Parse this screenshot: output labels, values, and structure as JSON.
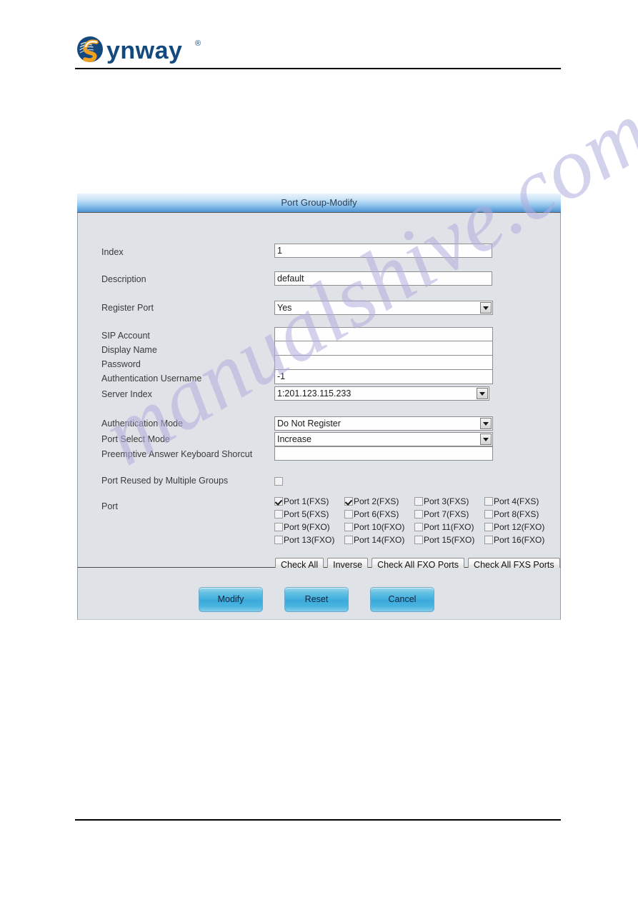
{
  "brand": {
    "logo_text": "ynway",
    "logo_mark": "s-swirl-icon",
    "trademark": "®"
  },
  "panel": {
    "title": "Port Group-Modify"
  },
  "form": {
    "fields": [
      {
        "label": "Index",
        "type": "text",
        "value": "1",
        "name": "index"
      },
      {
        "label": "Description",
        "type": "text",
        "value": "default",
        "name": "description"
      },
      {
        "label": "Register Port",
        "type": "select",
        "value": "Yes",
        "name": "register-port"
      }
    ],
    "sip_block": [
      {
        "label": "SIP Account",
        "type": "text",
        "value": "",
        "name": "sip-account"
      },
      {
        "label": "Display Name",
        "type": "text",
        "value": "",
        "name": "display-name"
      },
      {
        "label": "Password",
        "type": "text",
        "value": "",
        "name": "password"
      },
      {
        "label": "Authentication Username",
        "type": "text",
        "value": "-1",
        "name": "authentication-username"
      },
      {
        "label": "Server Index",
        "type": "select",
        "value": "1:201.123.115.233",
        "name": "server-index"
      }
    ],
    "mode_block": [
      {
        "label": "Authentication Mode",
        "type": "select",
        "value": "Do Not Register",
        "name": "authentication-mode"
      },
      {
        "label": "Port Select Mode",
        "type": "select",
        "value": "Increase",
        "name": "port-select-mode"
      },
      {
        "label": "Preemptive Answer Keyboard Shorcut",
        "type": "text",
        "value": "",
        "name": "preemptive-answer-keyboard-shortcut"
      }
    ],
    "reuse": {
      "label": "Port Reused by Multiple Groups",
      "checked": false
    },
    "port_label": "Port",
    "ports": [
      {
        "label": "Port 1(FXS)",
        "checked": true
      },
      {
        "label": "Port 2(FXS)",
        "checked": true
      },
      {
        "label": "Port 3(FXS)",
        "checked": false
      },
      {
        "label": "Port 4(FXS)",
        "checked": false
      },
      {
        "label": "Port 5(FXS)",
        "checked": false
      },
      {
        "label": "Port 6(FXS)",
        "checked": false
      },
      {
        "label": "Port 7(FXS)",
        "checked": false
      },
      {
        "label": "Port 8(FXS)",
        "checked": false
      },
      {
        "label": "Port 9(FXO)",
        "checked": false
      },
      {
        "label": "Port 10(FXO)",
        "checked": false
      },
      {
        "label": "Port 11(FXO)",
        "checked": false
      },
      {
        "label": "Port 12(FXO)",
        "checked": false
      },
      {
        "label": "Port 13(FXO)",
        "checked": false
      },
      {
        "label": "Port 14(FXO)",
        "checked": false
      },
      {
        "label": "Port 15(FXO)",
        "checked": false
      },
      {
        "label": "Port 16(FXO)",
        "checked": false
      }
    ],
    "port_buttons": [
      {
        "label": "Check All",
        "name": "check-all-button"
      },
      {
        "label": "Inverse",
        "name": "inverse-button"
      },
      {
        "label": "Check All FXO Ports",
        "name": "check-all-fxo-ports-button"
      },
      {
        "label": "Check All FXS Ports",
        "name": "check-all-fxs-ports-button"
      }
    ],
    "actions": {
      "modify": "Modify",
      "reset": "Reset",
      "cancel": "Cancel"
    }
  },
  "watermark": {
    "text": "manualshive.com"
  },
  "colors": {
    "title_bar_top": "#eaf4fd",
    "title_bar_bottom": "#4d93d2",
    "panel_bg": "#dfe2e7",
    "action_button": "#3aaadc",
    "logo_blue": "#13497f",
    "logo_orange": "#f0a020",
    "watermark": "#b0aede"
  }
}
